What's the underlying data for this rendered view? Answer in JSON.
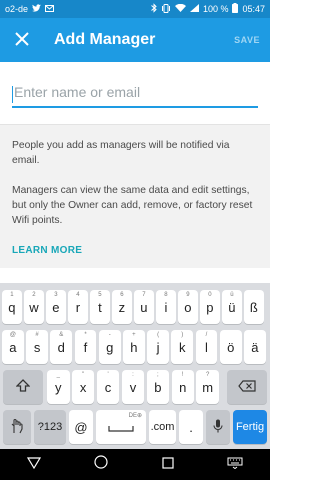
{
  "status": {
    "carrier": "o2-de",
    "battery": "100 %",
    "time": "05:47"
  },
  "appbar": {
    "title": "Add Manager",
    "save_label": "SAVE"
  },
  "form": {
    "placeholder": "Enter name or email",
    "value": ""
  },
  "info": {
    "para1": "People you add as managers will be notified via email.",
    "para2": "Managers can view the same data and edit settings, but only the Owner can add, remove, or factory reset Wifi points.",
    "learn_more": "LEARN MORE"
  },
  "keyboard": {
    "row1": [
      {
        "k": "q",
        "h": "1"
      },
      {
        "k": "w",
        "h": "2"
      },
      {
        "k": "e",
        "h": "3"
      },
      {
        "k": "r",
        "h": "4"
      },
      {
        "k": "t",
        "h": "5"
      },
      {
        "k": "z",
        "h": "6"
      },
      {
        "k": "u",
        "h": "7"
      },
      {
        "k": "i",
        "h": "8"
      },
      {
        "k": "o",
        "h": "9"
      },
      {
        "k": "p",
        "h": "0"
      },
      {
        "k": "ü",
        "h": "ü"
      },
      {
        "k": "ß",
        "h": ""
      }
    ],
    "row2": [
      {
        "k": "a",
        "h": "@"
      },
      {
        "k": "s",
        "h": "#"
      },
      {
        "k": "d",
        "h": "&"
      },
      {
        "k": "f",
        "h": "*"
      },
      {
        "k": "g",
        "h": "-"
      },
      {
        "k": "h",
        "h": "+"
      },
      {
        "k": "j",
        "h": "("
      },
      {
        "k": "k",
        "h": ")"
      },
      {
        "k": "l",
        "h": "/"
      },
      {
        "k": "ö",
        "h": ""
      },
      {
        "k": "ä",
        "h": ""
      }
    ],
    "row3": [
      {
        "k": "y",
        "h": "_"
      },
      {
        "k": "x",
        "h": "\""
      },
      {
        "k": "c",
        "h": "'"
      },
      {
        "k": "v",
        "h": ":"
      },
      {
        "k": "b",
        "h": ";"
      },
      {
        "k": "n",
        "h": "!"
      },
      {
        "k": "m",
        "h": "?"
      }
    ],
    "symbols_label": "?123",
    "at_label": "@",
    "space_hint": "DE⊕",
    "com_label": ".com",
    "dot_label": ".",
    "enter_label": "Fertig"
  }
}
